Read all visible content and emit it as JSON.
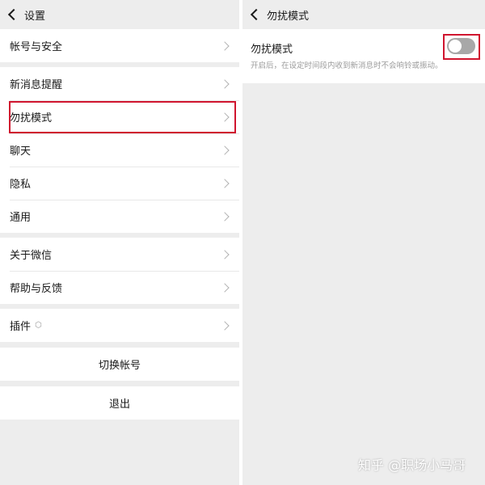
{
  "left": {
    "title": "设置",
    "group1": [
      {
        "label": "帐号与安全"
      }
    ],
    "group2": [
      {
        "label": "新消息提醒"
      },
      {
        "label": "勿扰模式"
      },
      {
        "label": "聊天"
      },
      {
        "label": "隐私"
      },
      {
        "label": "通用"
      }
    ],
    "group3": [
      {
        "label": "关于微信"
      },
      {
        "label": "帮助与反馈"
      }
    ],
    "group4": [
      {
        "label": "插件"
      }
    ],
    "switch_account": "切换帐号",
    "logout": "退出"
  },
  "right": {
    "title": "勿扰模式",
    "setting_label": "勿扰模式",
    "setting_desc": "开启后，在设定时间段内收到新消息时不会响铃或振动。",
    "toggle_on": false
  },
  "watermark": "知乎 @职场小马哥",
  "colors": {
    "highlight": "#d0152f",
    "background": "#ededed",
    "toggle_off": "#a8a8a8"
  }
}
